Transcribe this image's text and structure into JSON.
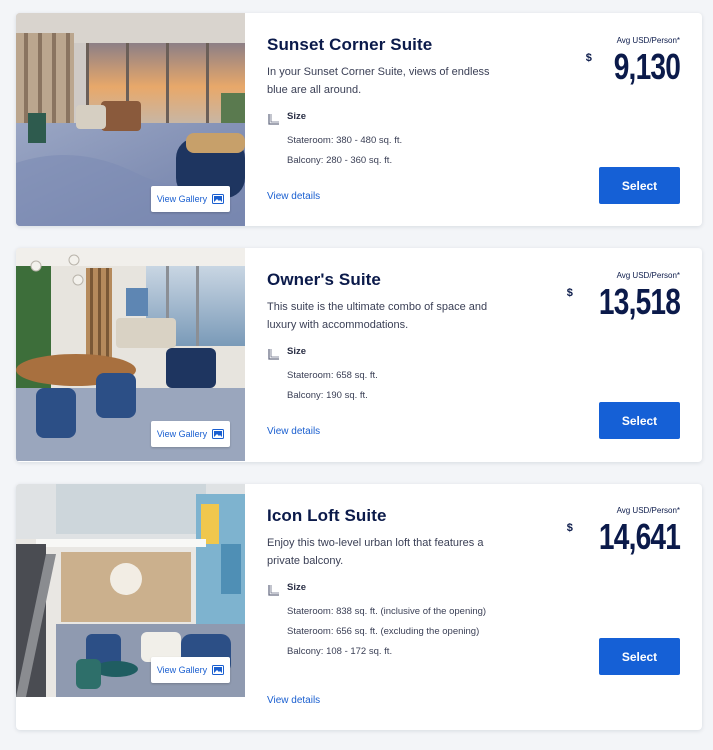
{
  "suites": [
    {
      "title": "Sunset Corner Suite",
      "description": "In your Sunset Corner Suite, views of endless blue are all around.",
      "size_label": "Size",
      "size_lines": [
        "Stateroom: 380 - 480 sq. ft.",
        "Balcony: 280 - 360 sq. ft."
      ],
      "details_label": "View details",
      "gallery_label": "View Gallery",
      "price_label": "Avg USD/Person*",
      "currency": "$",
      "price": "9,130",
      "select_label": "Select"
    },
    {
      "title": "Owner's Suite",
      "description": "This suite is the ultimate combo of space and luxury with accommodations.",
      "size_label": "Size",
      "size_lines": [
        "Stateroom: 658 sq. ft.",
        "Balcony: 190 sq. ft."
      ],
      "details_label": "View details",
      "gallery_label": "View Gallery",
      "price_label": "Avg USD/Person*",
      "currency": "$",
      "price": "13,518",
      "select_label": "Select"
    },
    {
      "title": "Icon Loft Suite",
      "description": "Enjoy this two-level urban loft that features a private balcony.",
      "size_label": "Size",
      "size_lines": [
        "Stateroom: 838 sq. ft. (inclusive of the opening)",
        "Stateroom: 656 sq. ft. (excluding the opening)",
        "Balcony: 108 - 172 sq. ft."
      ],
      "details_label": "View details",
      "gallery_label": "View Gallery",
      "price_label": "Avg USD/Person*",
      "currency": "$",
      "price": "14,641",
      "select_label": "Select"
    }
  ],
  "colors": {
    "accent": "#1560d6",
    "link": "#1a5fd0",
    "heading": "#0b1a4a",
    "background": "#f3f5f8"
  },
  "icons": [
    "size-icon",
    "gallery-icon"
  ]
}
